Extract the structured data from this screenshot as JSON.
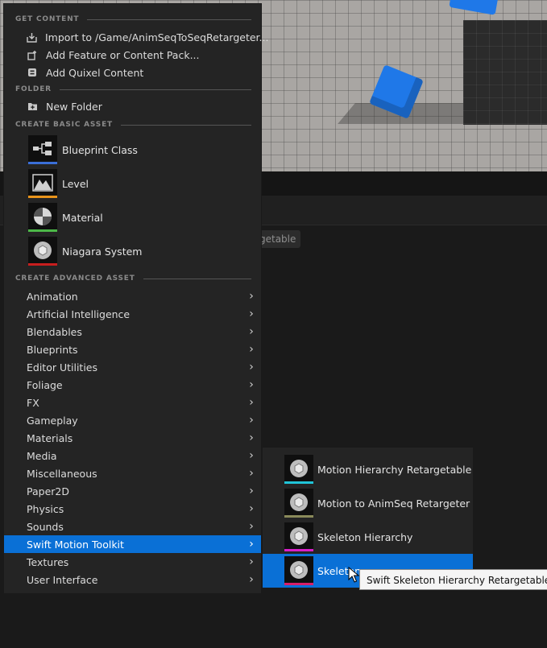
{
  "background": {
    "chip_text": "getable"
  },
  "menu": {
    "sections": {
      "get_content": "GET CONTENT",
      "folder": "FOLDER",
      "create_basic": "CREATE BASIC ASSET",
      "create_advanced": "CREATE ADVANCED ASSET"
    },
    "get_content_items": [
      {
        "label": "Import to /Game/AnimSeqToSeqRetargeter...",
        "icon": "import-icon"
      },
      {
        "label": "Add Feature or Content Pack...",
        "icon": "content-pack-icon"
      },
      {
        "label": "Add Quixel Content",
        "icon": "quixel-icon"
      }
    ],
    "folder_items": [
      {
        "label": "New Folder",
        "icon": "new-folder-icon"
      }
    ],
    "basic_assets": [
      {
        "label": "Blueprint Class",
        "icon": "blueprint-icon",
        "color": "#3a6fd8"
      },
      {
        "label": "Level",
        "icon": "level-icon",
        "color": "#e8931a"
      },
      {
        "label": "Material",
        "icon": "material-icon",
        "color": "#4cb848"
      },
      {
        "label": "Niagara System",
        "icon": "niagara-icon",
        "color": "#c81e1e"
      }
    ],
    "categories": [
      "Animation",
      "Artificial Intelligence",
      "Blendables",
      "Blueprints",
      "Editor Utilities",
      "Foliage",
      "FX",
      "Gameplay",
      "Materials",
      "Media",
      "Miscellaneous",
      "Paper2D",
      "Physics",
      "Sounds",
      "Swift Motion Toolkit",
      "Textures",
      "User Interface"
    ],
    "active_category": "Swift Motion Toolkit"
  },
  "submenu": {
    "items": [
      {
        "label": "Motion Hierarchy Retargetable",
        "color": "#20c4d8"
      },
      {
        "label": "Motion to AnimSeq Retargeter",
        "color": "#8a8a5a"
      },
      {
        "label": "Skeleton Hierarchy",
        "color": "#d81ec8"
      },
      {
        "label": "Skeleton",
        "color": "#d81e6a"
      }
    ],
    "active_index": 3
  },
  "tooltip": {
    "text": "Swift Skeleton Hierarchy Retargetable"
  }
}
